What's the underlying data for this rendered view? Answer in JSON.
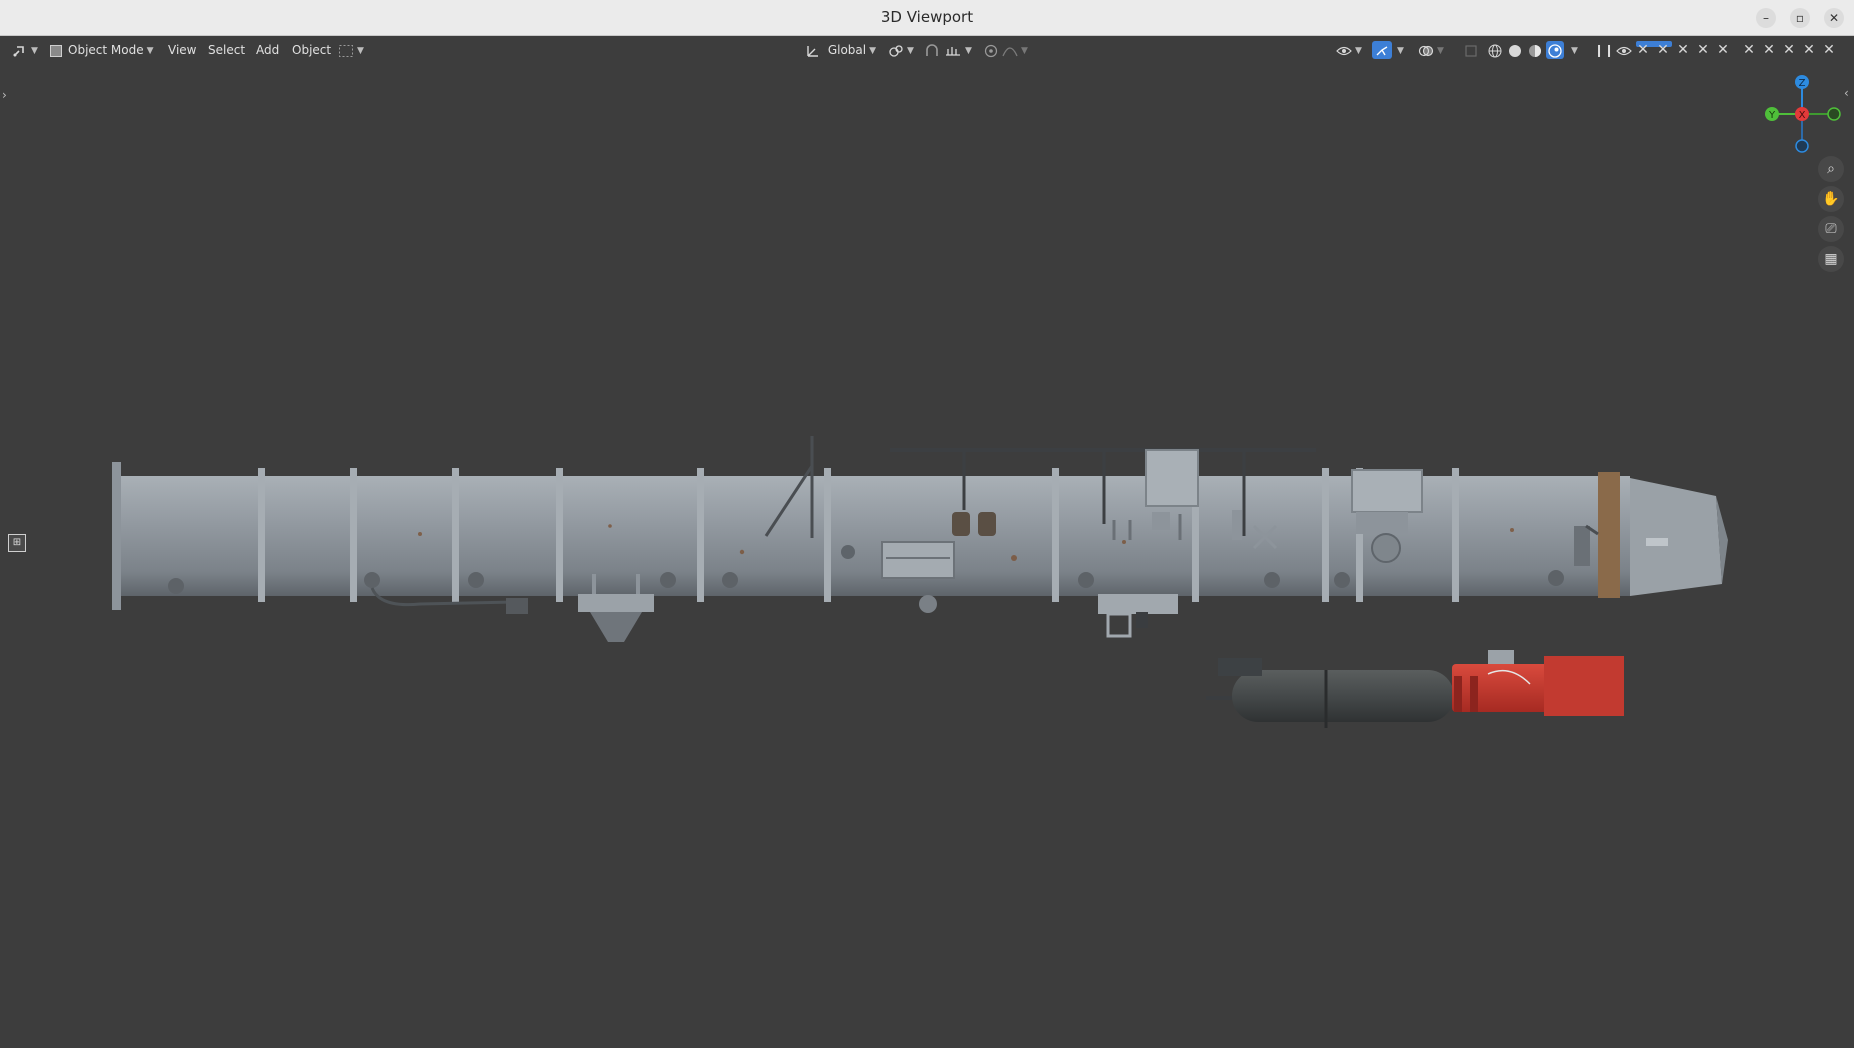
{
  "window": {
    "title": "3D Viewport",
    "buttons": {
      "minimize": "–",
      "maximize": "▫",
      "close": "✕"
    }
  },
  "header": {
    "editor_type_icon": "editor-type-icon",
    "mode_label": "Object Mode",
    "menus": [
      "View",
      "Select",
      "Add",
      "Object"
    ],
    "transform_orientation": "Global",
    "icons": {
      "pivot": "pivot-icon",
      "snap": "snap-icon",
      "proportional": "proportional-editing-icon",
      "visibility": "visibility-icon",
      "gizmo": "gizmo-icon",
      "overlay": "overlay-icon",
      "xray": "xray-icon",
      "shading_wire": "wireframe-shading-icon",
      "shading_solid": "solid-shading-icon",
      "shading_material": "material-shading-icon",
      "shading_rendered": "rendered-shading-icon"
    },
    "colors": {
      "active_blue": "#3d7fd6"
    }
  },
  "viewport": {
    "background": "#3d3d3d",
    "navigation": {
      "axes": {
        "z": "Z",
        "y": "Y",
        "x": "X"
      },
      "colors": {
        "x": "#e23a3a",
        "y": "#4fbf3a",
        "z": "#2d8be0"
      }
    },
    "nav_icons": [
      "zoom-icon",
      "pan-hand-icon",
      "camera-icon",
      "grid-toggle-icon"
    ],
    "object": {
      "name": "rocket-tube-model",
      "body_color": "#8d949b",
      "accent_color": "#c4332b"
    }
  }
}
